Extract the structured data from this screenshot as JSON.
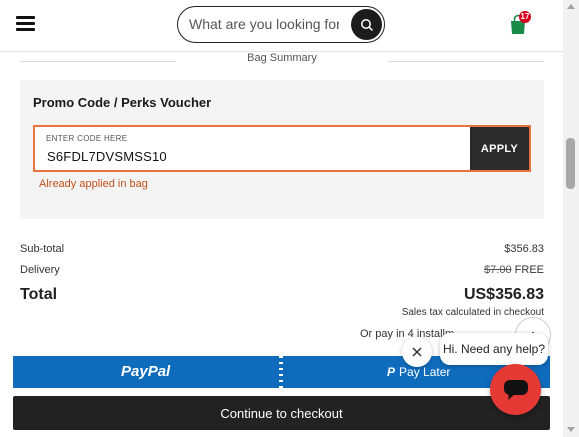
{
  "header": {
    "search_placeholder": "What are you looking for?",
    "bag_count": "17"
  },
  "summary": {
    "title": "Bag Summary"
  },
  "promo": {
    "title": "Promo Code / Perks Voucher",
    "field_label": "ENTER CODE HERE",
    "field_value": "S6FDL7DVSMSS10",
    "apply_label": "APPLY",
    "error": "Already applied in bag"
  },
  "totals": {
    "subtotal_label": "Sub-total",
    "subtotal_value": "$356.83",
    "delivery_label": "Delivery",
    "delivery_old": "$7.00",
    "delivery_value": "FREE",
    "total_label": "Total",
    "total_value": "US$356.83",
    "tax_note": "Sales tax calculated in checkout",
    "installments": "Or pay in 4 installm"
  },
  "payment": {
    "paypal_label": "PayPal",
    "paylater_label": "Pay Later"
  },
  "checkout": {
    "label": "Continue to checkout"
  },
  "chat": {
    "bubble_text": "Hi. Need any help?"
  },
  "colors": {
    "promo_border": "#e8743b",
    "error_text": "#c0501a",
    "paypal_blue": "#0f6cbd",
    "chat_red": "#e53935",
    "bag_green": "#1a8a4a"
  }
}
